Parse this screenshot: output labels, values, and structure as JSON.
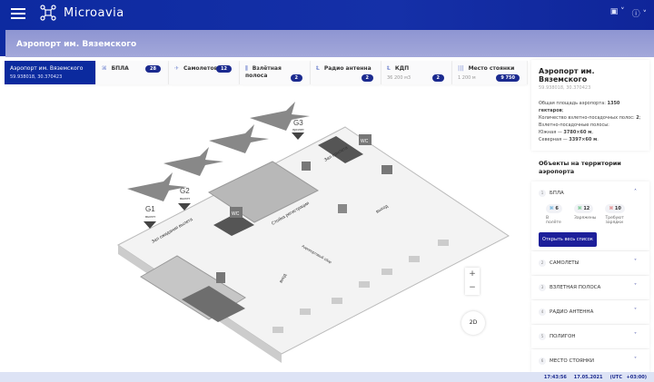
{
  "app": {
    "brand": "Microavia"
  },
  "page_title": "Аэропорт им. Вяземского",
  "tabs": [
    {
      "label": "Аэропорт им. Вяземского",
      "sub": "59.938018, 30.370423"
    },
    {
      "label": "БПЛА",
      "badge": "28"
    },
    {
      "label": "Самолетов",
      "badge": "12"
    },
    {
      "label": "Взлётная полоса",
      "badge": "2"
    },
    {
      "label": "Радио антенна",
      "badge": "2"
    },
    {
      "label": "КДП",
      "sub": "36 200 м3",
      "badge": "2"
    },
    {
      "label": "Место стоянки",
      "sub": "1 200 м",
      "badge": "9 750"
    }
  ],
  "info": {
    "title": "Аэропорт им. Вяземского",
    "coords": "59.938018, 30.370423",
    "l1a": "Общая площадь аэропорта: ",
    "l1b": "1350 гектаров",
    "l2a": "Количество взлетно-посадочных полос: ",
    "l2b": "2",
    "l3": "Взлетно-посадочные полосы:",
    "l4a": "Южная — ",
    "l4b": "3780×60 м",
    "l5a": "Северная — ",
    "l5b": "3397×60 м"
  },
  "objects": {
    "title": "Объекты на территории аэропорта",
    "items": [
      {
        "n": "1",
        "label": "БПЛА"
      },
      {
        "n": "2",
        "label": "САМОЛЕТЫ"
      },
      {
        "n": "3",
        "label": "ВЗЛЕТНАЯ ПОЛОСА"
      },
      {
        "n": "4",
        "label": "РАДИО АНТЕННА"
      },
      {
        "n": "5",
        "label": "ПОЛИГОН"
      },
      {
        "n": "6",
        "label": "МЕСТО СТОЯНКИ"
      }
    ],
    "stats": [
      {
        "v": "6",
        "l": "В полёте",
        "c": "#9fd0f0"
      },
      {
        "v": "12",
        "l": "Заряжены",
        "c": "#a9e3b8"
      },
      {
        "v": "10",
        "l": "Требуют зарядки",
        "c": "#f5b5b5"
      }
    ],
    "open_all": "Открыть весь список"
  },
  "map": {
    "g1": "G1",
    "g1s": "вылет",
    "g2": "G2",
    "g2s": "вылет",
    "g3": "G3",
    "g3s": "прилет",
    "wait": "Зал ожидания вылета",
    "arr": "Зал прилета",
    "checkin": "Стойка регистрации",
    "fee": "Аэропортовый сбор",
    "exit": "выход",
    "entry": "вход",
    "wc": "WC",
    "zoom_in": "+",
    "zoom_out": "−",
    "mode": "2D"
  },
  "footer": {
    "time": "17:43:56",
    "date": "17.05.2021",
    "tz": "(UTC +03:00)"
  }
}
